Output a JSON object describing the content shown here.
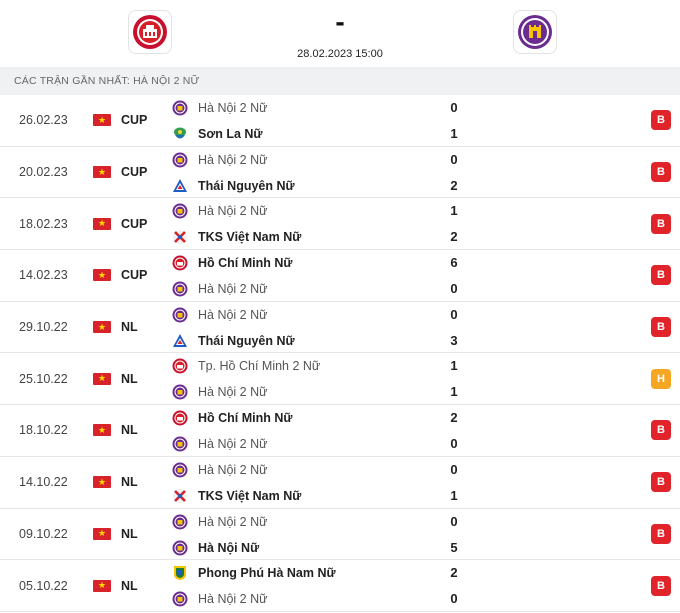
{
  "header": {
    "home_logo_icon": "hcm-club-crest-icon",
    "away_logo_icon": "hanoi-club-crest-icon",
    "score": "-",
    "datetime": "28.02.2023 15:00"
  },
  "section_title": "CÁC TRẬN GẦN NHẤT: HÀ NỘI 2 NỮ",
  "colors": {
    "lose": "#e0242a",
    "draw": "#f5a623",
    "flag": "#d8232a"
  },
  "matches": [
    {
      "date": "26.02.23",
      "comp": "CUP",
      "home": "Hà Nội 2 Nữ",
      "home_logo": "hanoi",
      "home_bold": false,
      "away": "Sơn La Nữ",
      "away_logo": "sonla",
      "away_bold": true,
      "home_score": "0",
      "away_score": "1",
      "result": "B",
      "result_type": "lose"
    },
    {
      "date": "20.02.23",
      "comp": "CUP",
      "home": "Hà Nội 2 Nữ",
      "home_logo": "hanoi",
      "home_bold": false,
      "away": "Thái Nguyên Nữ",
      "away_logo": "thainguyen",
      "away_bold": true,
      "home_score": "0",
      "away_score": "2",
      "result": "B",
      "result_type": "lose"
    },
    {
      "date": "18.02.23",
      "comp": "CUP",
      "home": "Hà Nội 2 Nữ",
      "home_logo": "hanoi",
      "home_bold": false,
      "away": "TKS Việt Nam Nữ",
      "away_logo": "tks",
      "away_bold": true,
      "home_score": "1",
      "away_score": "2",
      "result": "B",
      "result_type": "lose"
    },
    {
      "date": "14.02.23",
      "comp": "CUP",
      "home": "Hồ Chí Minh Nữ",
      "home_logo": "hcm",
      "home_bold": true,
      "away": "Hà Nội 2 Nữ",
      "away_logo": "hanoi",
      "away_bold": false,
      "home_score": "6",
      "away_score": "0",
      "result": "B",
      "result_type": "lose"
    },
    {
      "date": "29.10.22",
      "comp": "NL",
      "home": "Hà Nội 2 Nữ",
      "home_logo": "hanoi",
      "home_bold": false,
      "away": "Thái Nguyên Nữ",
      "away_logo": "thainguyen",
      "away_bold": true,
      "home_score": "0",
      "away_score": "3",
      "result": "B",
      "result_type": "lose"
    },
    {
      "date": "25.10.22",
      "comp": "NL",
      "home": "Tp. Hồ Chí Minh 2 Nữ",
      "home_logo": "hcm",
      "home_bold": false,
      "away": "Hà Nội 2 Nữ",
      "away_logo": "hanoi",
      "away_bold": false,
      "home_score": "1",
      "away_score": "1",
      "result": "H",
      "result_type": "draw"
    },
    {
      "date": "18.10.22",
      "comp": "NL",
      "home": "Hồ Chí Minh Nữ",
      "home_logo": "hcm",
      "home_bold": true,
      "away": "Hà Nội 2 Nữ",
      "away_logo": "hanoi",
      "away_bold": false,
      "home_score": "2",
      "away_score": "0",
      "result": "B",
      "result_type": "lose"
    },
    {
      "date": "14.10.22",
      "comp": "NL",
      "home": "Hà Nội 2 Nữ",
      "home_logo": "hanoi",
      "home_bold": false,
      "away": "TKS Việt Nam Nữ",
      "away_logo": "tks",
      "away_bold": true,
      "home_score": "0",
      "away_score": "1",
      "result": "B",
      "result_type": "lose"
    },
    {
      "date": "09.10.22",
      "comp": "NL",
      "home": "Hà Nội 2 Nữ",
      "home_logo": "hanoi",
      "home_bold": false,
      "away": "Hà Nội Nữ",
      "away_logo": "hanoi",
      "away_bold": true,
      "home_score": "0",
      "away_score": "5",
      "result": "B",
      "result_type": "lose"
    },
    {
      "date": "05.10.22",
      "comp": "NL",
      "home": "Phong Phú Hà Nam Nữ",
      "home_logo": "phongphu",
      "home_bold": true,
      "away": "Hà Nội 2 Nữ",
      "away_logo": "hanoi",
      "away_bold": false,
      "home_score": "2",
      "away_score": "0",
      "result": "B",
      "result_type": "lose"
    }
  ]
}
